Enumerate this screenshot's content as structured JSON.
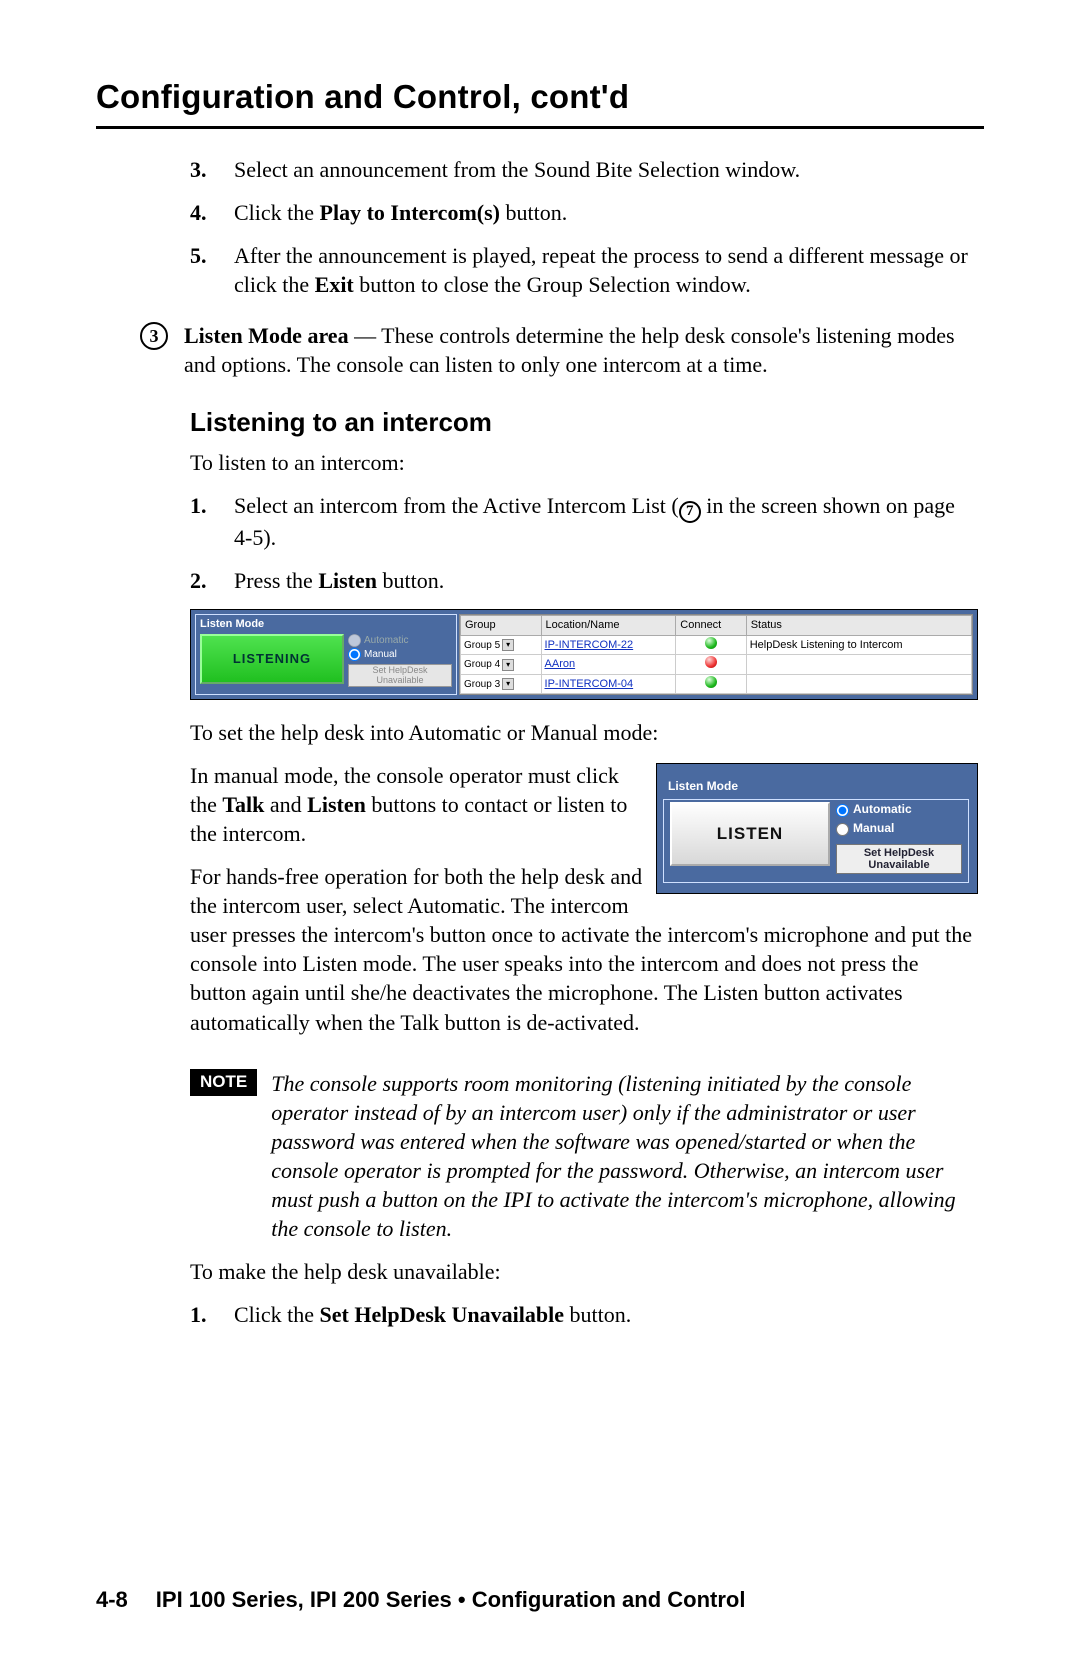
{
  "header": {
    "title": "Configuration and Control, cont'd"
  },
  "steps_a": [
    {
      "n": "3.",
      "text": "Select an announcement from the Sound Bite Selection window."
    },
    {
      "n": "4.",
      "pre": "Click the ",
      "bold": "Play to Intercom(s)",
      "post": " button."
    },
    {
      "n": "5.",
      "pre": "After the announcement is played, repeat the process to send a different message or click the ",
      "bold": "Exit",
      "post": " button to close the Group Selection window."
    }
  ],
  "marker3": {
    "num": "3",
    "bold": "Listen Mode area",
    "rest": " — These controls determine the help desk console's listening modes and options.  The console can listen to only one intercom at a time."
  },
  "h2": "Listening to an intercom",
  "p_intro": "To listen to an intercom:",
  "steps_b": {
    "s1": {
      "n": "1.",
      "pre": "Select an intercom from the Active Intercom List (",
      "circ": "7",
      "post": " in the screen shown on page 4-5)."
    },
    "s2": {
      "n": "2.",
      "pre": "Press the ",
      "bold": "Listen",
      "post": " button."
    }
  },
  "fig1": {
    "lm_title": "Listen Mode",
    "btn": "LISTENING",
    "opt_auto": "Automatic",
    "opt_manual": "Manual",
    "set_btn": "Set HelpDesk Unavailable",
    "cols": {
      "group": "Group",
      "loc": "Location/Name",
      "conn": "Connect",
      "status": "Status"
    },
    "rows": [
      {
        "g": "Group 5",
        "name": "IP-INTERCOM-22",
        "dot": "g",
        "status": "HelpDesk Listening to Intercom"
      },
      {
        "g": "Group 4",
        "name": "AAron",
        "dot": "r",
        "status": ""
      },
      {
        "g": "Group 3",
        "name": "IP-INTERCOM-04",
        "dot": "g",
        "status": ""
      }
    ]
  },
  "p_setmode": "To set the help desk into Automatic or Manual mode:",
  "p_manual": {
    "pre": "In manual mode, the console operator must click the ",
    "b1": "Talk",
    "mid": " and ",
    "b2": "Listen",
    "post": " buttons to contact or listen to the intercom."
  },
  "p_hands": "For hands-free operation for both the  help desk and the intercom user, select Automatic. The intercom user presses the intercom's button once to activate the intercom's microphone and put the console into Listen mode.  The user speaks into the intercom and does not press the button again until she/he deactivates the microphone. The Listen button activates automatically when the Talk button is de-activated.",
  "fig2": {
    "lm_title": "Listen Mode",
    "btn": "LISTEN",
    "opt_auto": "Automatic",
    "opt_manual": "Manual",
    "set_btn_l1": "Set HelpDesk",
    "set_btn_l2": "Unavailable"
  },
  "note": {
    "tag": "NOTE",
    "text": "The console supports room monitoring (listening initiated by the console operator instead of by an intercom user) only if the administrator or user password was entered when the software was opened/started or when the console operator is prompted for the password.  Otherwise, an intercom user must push a button on the IPI to activate the intercom's microphone, allowing the console to listen."
  },
  "p_unavail": "To make the  help desk unavailable:",
  "steps_c": {
    "n": "1.",
    "pre": "Click the ",
    "bold": "Set HelpDesk Unavailable",
    "post": " button."
  },
  "footer": {
    "page": "4-8",
    "text": "IPI 100 Series, IPI 200 Series • Configuration and Control"
  }
}
